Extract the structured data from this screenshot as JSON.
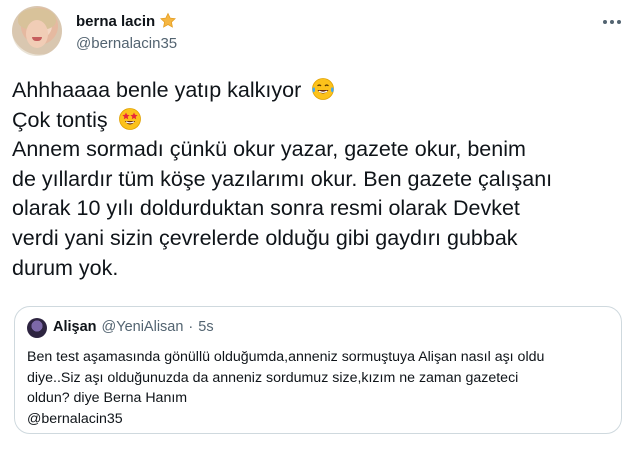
{
  "author": {
    "display_name": "berna lacin",
    "handle": "@bernalacin35",
    "badge_icon": "star-badge-icon"
  },
  "tweet": {
    "lines": [
      "Ahhhaaaa benle yatıp kalkıyor",
      "Çok tontiş",
      "Annem sormadı çünkü okur yazar, gazete okur, benim",
      "de yıllardır tüm köşe yazılarımı okur. Ben gazete çalışanı",
      "olarak 10 yılı doldurduktan sonra resmi olarak Devket",
      "verdi yani sizin çevrelerde olduğu gibi gaydırı gubbak",
      "durum yok."
    ],
    "emojis": [
      "tears-of-joy-emoji",
      "star-struck-emoji"
    ]
  },
  "quoted_tweet": {
    "display_name": "Alişan",
    "handle": "@YeniAlisan",
    "separator": "·",
    "time": "5s",
    "lines": [
      "Ben test aşamasında gönüllü olduğumda,anneniz sormuştuya Alişan nasıl aşı oldu",
      "diye..Siz aşı olduğunuzda da anneniz sordumuz size,kızım ne zaman gazeteci",
      "oldun? diye Berna Hanım",
      "@bernalacin35"
    ]
  },
  "colors": {
    "text": "#0f1419",
    "secondary": "#536471",
    "border": "#cfd9de",
    "star": "#f5b642"
  }
}
